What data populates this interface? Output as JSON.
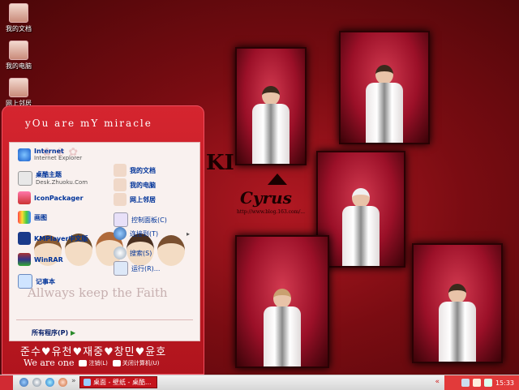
{
  "desktop_icons": [
    {
      "label": "我的文档",
      "icon": "my-documents-icon"
    },
    {
      "label": "我的电脑",
      "icon": "my-computer-icon"
    },
    {
      "label": "网上邻居",
      "icon": "network-places-icon"
    }
  ],
  "wallpaper": {
    "logo_text": "KI",
    "script_text": "Cyrus",
    "url_text": "http://www.blog.163.com/..."
  },
  "start_menu": {
    "title": "yOu are mY miracle",
    "left_items": [
      {
        "label": "Internet",
        "sub": "Internet Explorer",
        "icon": "internet-explorer-icon"
      },
      {
        "label": "桌酷主题",
        "sub": "Desk.Zhuoku.Com",
        "icon": "zhuoku-theme-icon"
      },
      {
        "label": "IconPackager",
        "sub": "",
        "icon": "iconpackager-icon"
      },
      {
        "label": "画图",
        "sub": "",
        "icon": "paint-icon"
      },
      {
        "label": "KMPlayer中文版",
        "sub": "",
        "icon": "kmplayer-icon"
      },
      {
        "label": "WinRAR",
        "sub": "",
        "icon": "winrar-icon"
      },
      {
        "label": "记事本",
        "sub": "",
        "icon": "notepad-icon"
      }
    ],
    "right_items": [
      {
        "label": "我的文档",
        "icon": "my-documents-icon"
      },
      {
        "label": "我的电脑",
        "icon": "my-computer-icon"
      },
      {
        "label": "网上邻居",
        "icon": "network-places-icon"
      },
      {
        "label": "控制面板(C)",
        "icon": "control-panel-icon"
      },
      {
        "label": "连接到(T)",
        "icon": "connect-to-icon"
      },
      {
        "label": "搜索(S)",
        "icon": "search-icon"
      },
      {
        "label": "运行(R)...",
        "icon": "run-icon"
      }
    ],
    "watermark": "Allways keep the Faith",
    "all_programs": "所有程序(P)",
    "names": "준수♥유천♥재중♥창민♥윤호",
    "we_are_one": "We are one",
    "logoff_label": "注销(L)",
    "shutdown_label": "关闭计算机(U)"
  },
  "taskbar": {
    "window_title": "桌面 - 壁纸 - 桌酷...",
    "clock": "15:33"
  },
  "colors": {
    "accent": "#c4141c",
    "menu_bg": "#f9f1ef",
    "link": "#003399"
  }
}
